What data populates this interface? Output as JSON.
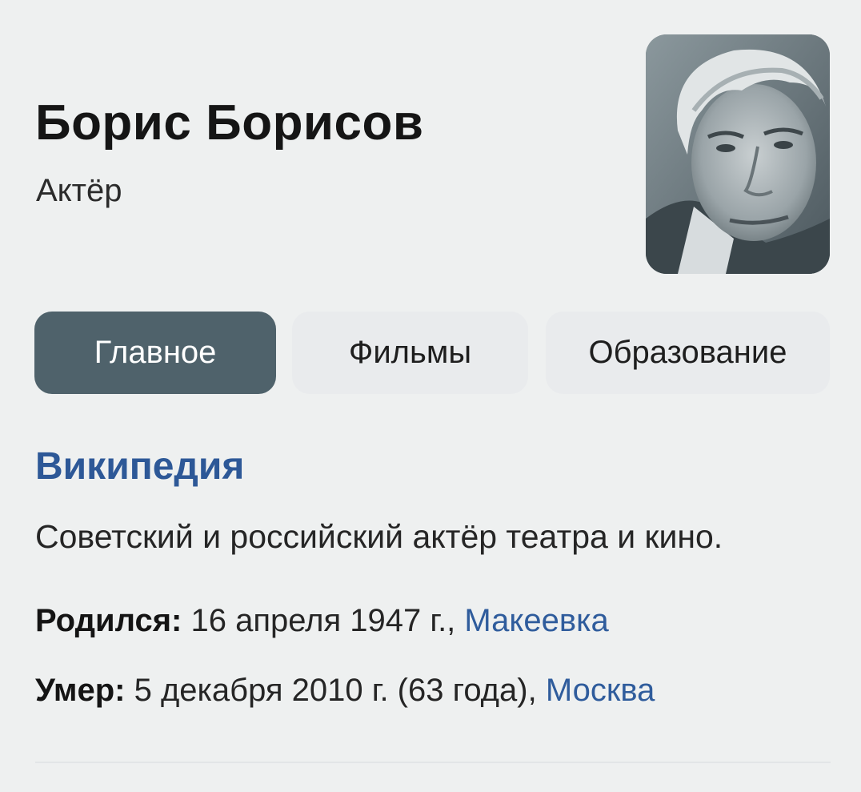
{
  "header": {
    "name": "Борис Борисов",
    "role": "Актёр"
  },
  "tabs": [
    {
      "label": "Главное",
      "active": true
    },
    {
      "label": "Фильмы",
      "active": false
    },
    {
      "label": "Образование",
      "active": false
    }
  ],
  "wiki": {
    "title": "Википедия",
    "description": "Советский и российский актёр театра и кино.",
    "born": {
      "label": "Родился:",
      "value": " 16 апреля 1947 г., ",
      "place": "Макеевка"
    },
    "died": {
      "label": "Умер:",
      "value": " 5 декабря 2010 г. (63 года), ",
      "place": "Москва"
    }
  },
  "colors": {
    "background": "#eef0f0",
    "active_tab": "#4f626b",
    "inactive_tab": "#e9ebed",
    "link": "#2f5c9c",
    "source_title": "#2d5897"
  }
}
